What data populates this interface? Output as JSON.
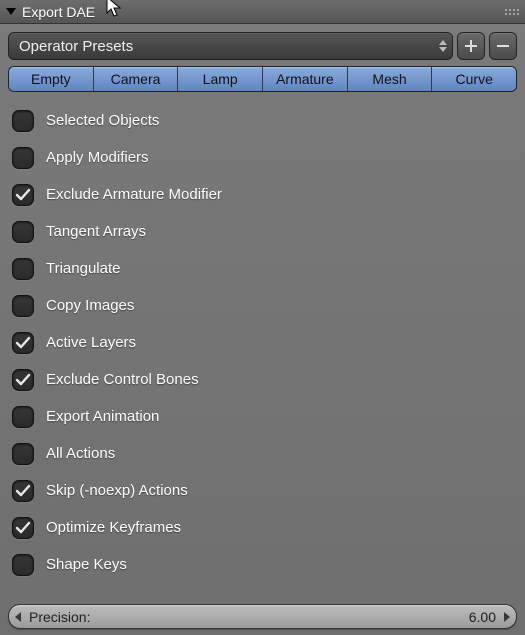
{
  "header": {
    "title": "Export DAE"
  },
  "presets": {
    "label": "Operator Presets"
  },
  "type_buttons": [
    "Empty",
    "Camera",
    "Lamp",
    "Armature",
    "Mesh",
    "Curve"
  ],
  "options": [
    {
      "label": "Selected Objects",
      "checked": false
    },
    {
      "label": "Apply Modifiers",
      "checked": false
    },
    {
      "label": "Exclude Armature Modifier",
      "checked": true
    },
    {
      "label": "Tangent Arrays",
      "checked": false
    },
    {
      "label": "Triangulate",
      "checked": false
    },
    {
      "label": "Copy Images",
      "checked": false
    },
    {
      "label": "Active Layers",
      "checked": true
    },
    {
      "label": "Exclude Control Bones",
      "checked": true
    },
    {
      "label": "Export Animation",
      "checked": false
    },
    {
      "label": "All Actions",
      "checked": false
    },
    {
      "label": "Skip (-noexp) Actions",
      "checked": true
    },
    {
      "label": "Optimize Keyframes",
      "checked": true
    },
    {
      "label": "Shape Keys",
      "checked": false
    }
  ],
  "precision": {
    "label": "Precision:",
    "value": "6.00"
  }
}
